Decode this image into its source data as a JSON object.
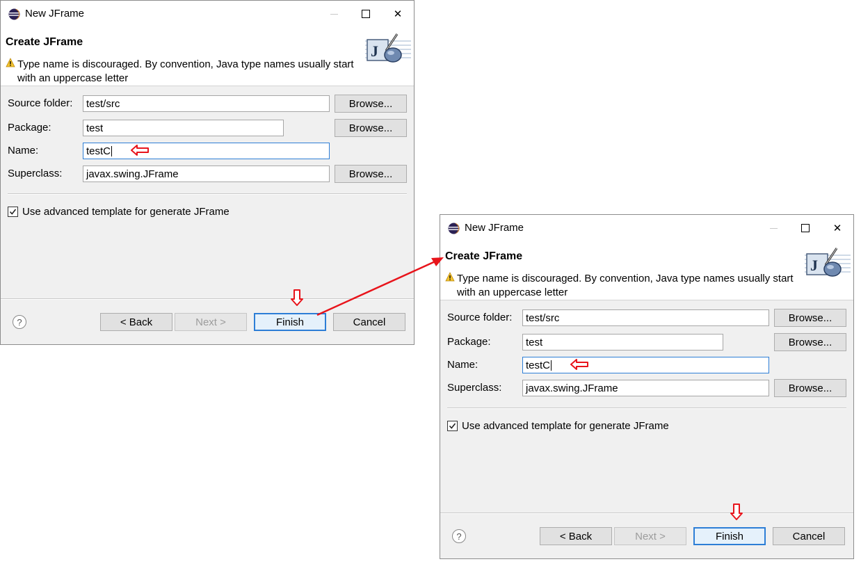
{
  "window": {
    "title": "New JFrame",
    "close_glyph": "✕"
  },
  "header": {
    "title": "Create JFrame",
    "warning": "Type name is discouraged. By convention, Java type names usually start with an uppercase letter",
    "banner_letter": "J"
  },
  "form": {
    "source_folder_label": "Source folder:",
    "source_folder_value": "test/src",
    "package_label": "Package:",
    "package_value": "test",
    "name_label": "Name:",
    "name_value": "testC",
    "superclass_label": "Superclass:",
    "superclass_value": "javax.swing.JFrame",
    "browse_label": "Browse...",
    "advanced_template_label": "Use advanced template for generate JFrame",
    "advanced_template_checked": true
  },
  "footer": {
    "help_glyph": "?",
    "back_label": "< Back",
    "next_label": "Next >",
    "finish_label": "Finish",
    "cancel_label": "Cancel"
  },
  "colors": {
    "annotation_red": "#e8141b",
    "focus_blue": "#2d7ed6",
    "dialog_bg": "#f0f0f0"
  }
}
